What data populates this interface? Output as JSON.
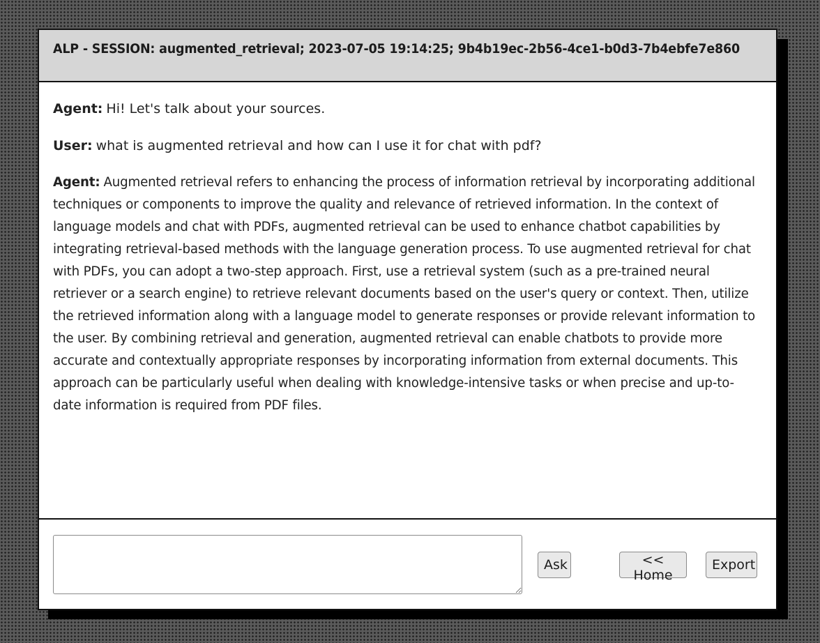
{
  "header": {
    "title": "ALP - SESSION: augmented_retrieval; 2023-07-05 19:14:25; 9b4b19ec-2b56-4ce1-b0d3-7b4ebfe7e860"
  },
  "conversation": {
    "messages": [
      {
        "speaker": "Agent:",
        "text": "Hi! Let's talk about your sources."
      },
      {
        "speaker": "User:",
        "text": "what is augmented retrieval and how can I use it for chat with pdf?"
      },
      {
        "speaker": "Agent:",
        "text": "Augmented retrieval refers to enhancing the process of information retrieval by incorporating additional techniques or components to improve the quality and relevance of retrieved information. In the context of language models and chat with PDFs, augmented retrieval can be used to enhance chatbot capabilities by integrating retrieval-based methods with the language generation process. To use augmented retrieval for chat with PDFs, you can adopt a two-step approach. First, use a retrieval system (such as a pre-trained neural retriever or a search engine) to retrieve relevant documents based on the user's query or context. Then, utilize the retrieved information along with a language model to generate responses or provide relevant information to the user. By combining retrieval and generation, augmented retrieval can enable chatbots to provide more accurate and contextually appropriate responses by incorporating information from external documents. This approach can be particularly useful when dealing with knowledge-intensive tasks or when precise and up-to-date information is required from PDF files."
      }
    ]
  },
  "footer": {
    "input_value": "",
    "ask_label": "Ask",
    "home_label": "<< Home",
    "export_label": "Export"
  }
}
